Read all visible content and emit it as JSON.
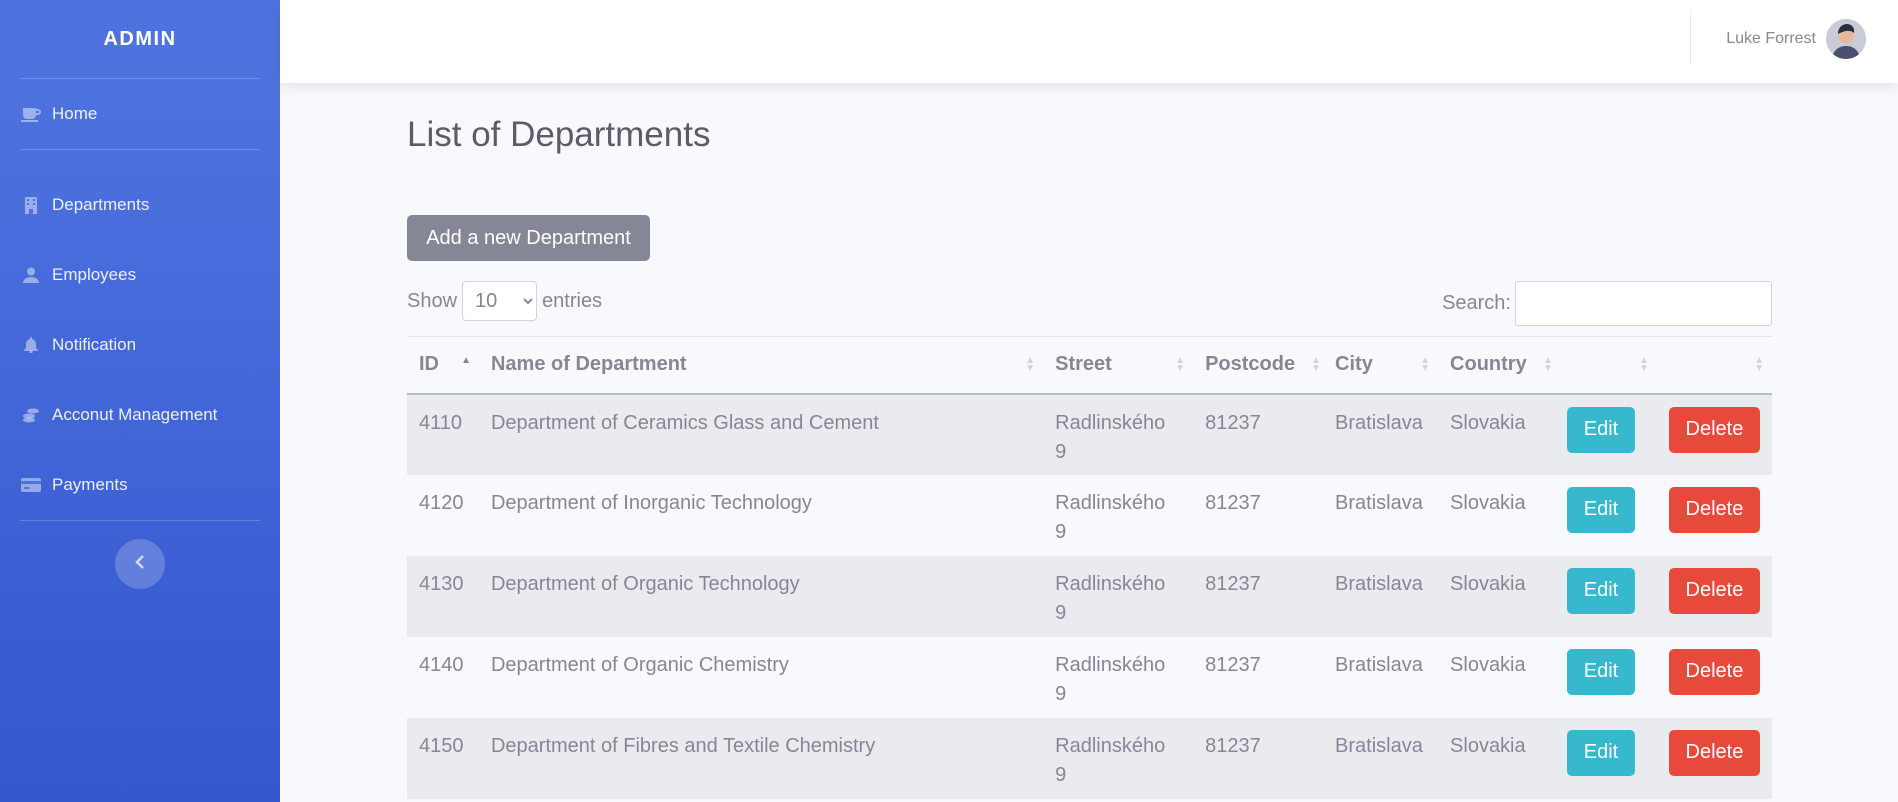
{
  "sidebar": {
    "brand": "ADMIN",
    "items": [
      {
        "label": "Home",
        "icon": "coffee-cup-icon"
      },
      {
        "label": "Departments",
        "icon": "building-icon"
      },
      {
        "label": "Employees",
        "icon": "user-icon"
      },
      {
        "label": "Notification",
        "icon": "bell-icon"
      },
      {
        "label": "Acconut Management",
        "icon": "coins-icon"
      },
      {
        "label": "Payments",
        "icon": "credit-card-icon"
      }
    ],
    "toggle_icon": "chevron-left-icon"
  },
  "topbar": {
    "user_name": "Luke Forrest",
    "avatar_icon": "user-avatar"
  },
  "page": {
    "title": "List of Departments",
    "add_button": "Add a new Department",
    "show_label": "Show",
    "entries_label": "entries",
    "page_length": "10",
    "search_label": "Search:",
    "search_value": ""
  },
  "table": {
    "columns": [
      "ID",
      "Name of Department",
      "Street",
      "Postcode",
      "City",
      "Country",
      "",
      ""
    ],
    "edit_label": "Edit",
    "delete_label": "Delete",
    "rows": [
      {
        "id": "4110",
        "name": "Department of Ceramics Glass and Cement",
        "street": "Radlinského 9",
        "postcode": "81237",
        "city": "Bratislava",
        "country": "Slovakia"
      },
      {
        "id": "4120",
        "name": "Department of Inorganic Technology",
        "street": "Radlinského 9",
        "postcode": "81237",
        "city": "Bratislava",
        "country": "Slovakia"
      },
      {
        "id": "4130",
        "name": "Department of Organic Technology",
        "street": "Radlinského 9",
        "postcode": "81237",
        "city": "Bratislava",
        "country": "Slovakia"
      },
      {
        "id": "4140",
        "name": "Department of Organic Chemistry",
        "street": "Radlinského 9",
        "postcode": "81237",
        "city": "Bratislava",
        "country": "Slovakia"
      },
      {
        "id": "4150",
        "name": "Department of Fibres and Textile Chemistry",
        "street": "Radlinského 9",
        "postcode": "81237",
        "city": "Bratislava",
        "country": "Slovakia"
      }
    ]
  },
  "colors": {
    "sidebar": "#4e73df",
    "edit": "#36b9cc",
    "delete": "#e74a3b",
    "add": "#858796"
  }
}
